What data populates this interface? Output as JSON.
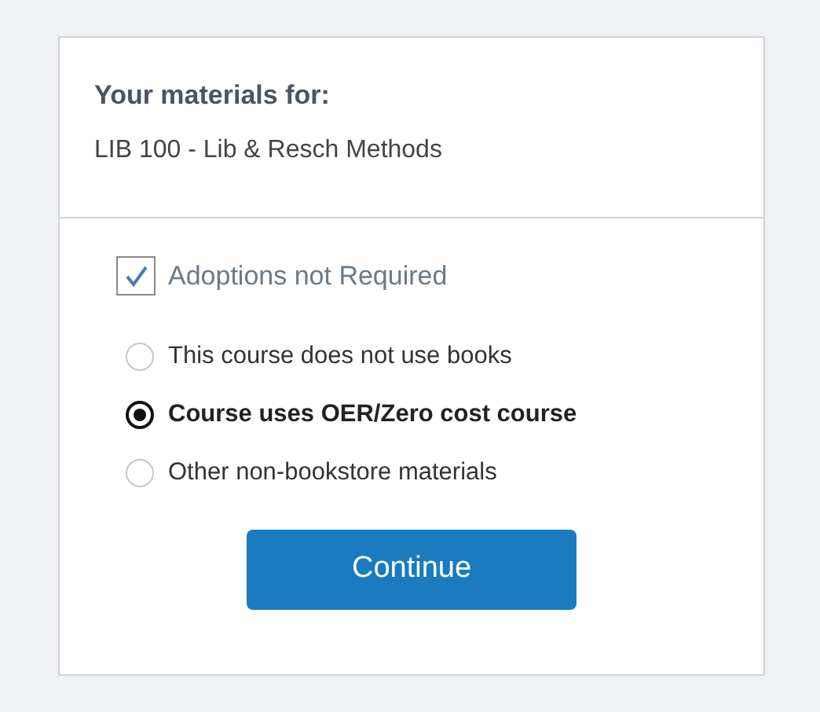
{
  "header": {
    "title": "Your materials for:",
    "course": "LIB 100 - Lib & Resch Methods"
  },
  "adoption_checkbox": {
    "label": "Adoptions not Required",
    "checked": true
  },
  "options": [
    {
      "label": "This course does not use books",
      "selected": false
    },
    {
      "label": "Course uses OER/Zero cost course",
      "selected": true
    },
    {
      "label": "Other non-bookstore materials",
      "selected": false
    }
  ],
  "button": "Continue"
}
